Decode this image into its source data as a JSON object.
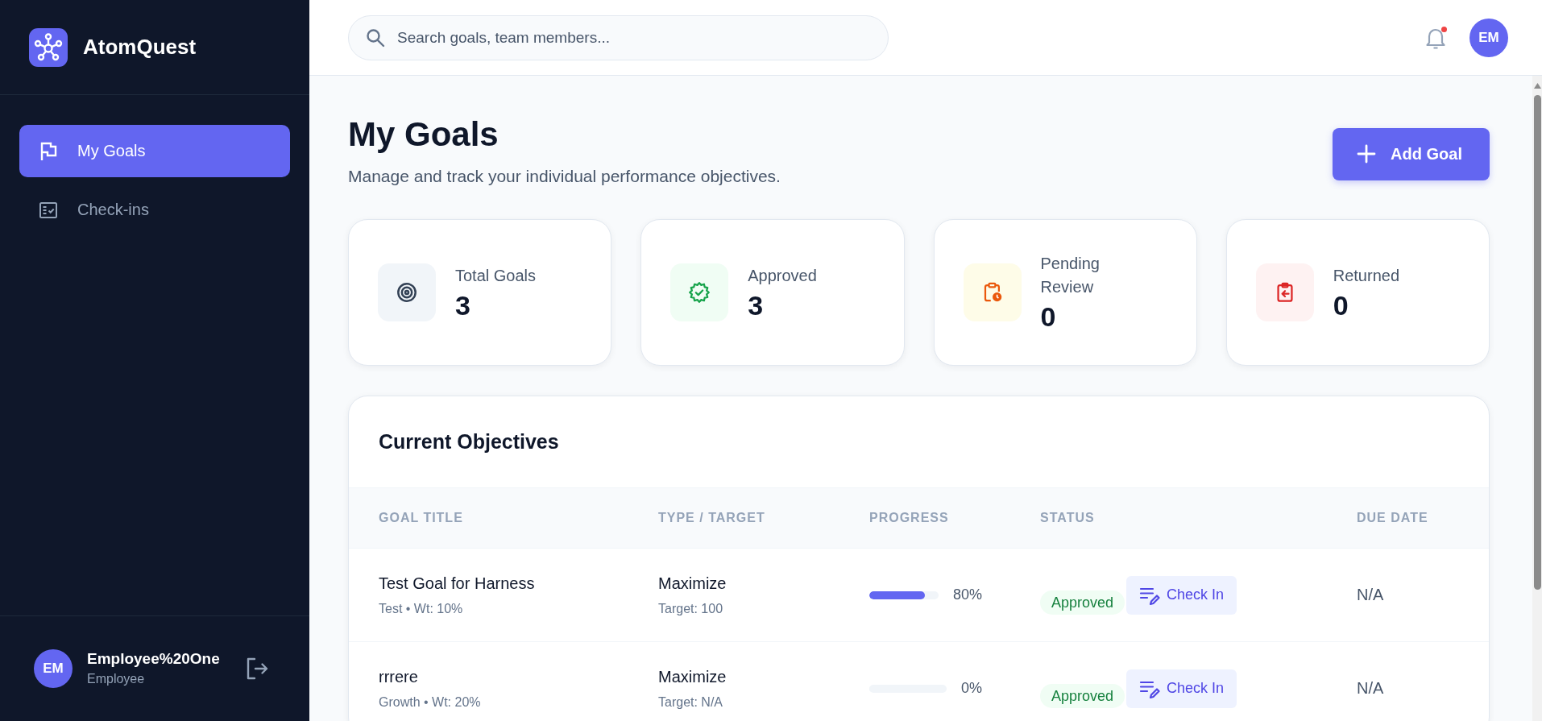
{
  "sidebar": {
    "brand": "AtomQuest",
    "nav_items": [
      {
        "label": "My Goals",
        "kind": "goals",
        "selected": true
      },
      {
        "label": "Check-ins",
        "kind": "checkins",
        "selected": false
      }
    ],
    "user": {
      "initials": "EM",
      "name": "Employee%20One",
      "role": "Employee"
    }
  },
  "topbar": {
    "search": {
      "placeholder": "Search goals, team members..."
    },
    "notifications": {
      "has_unread": true
    },
    "avatar": {
      "initials": "EM"
    }
  },
  "header": {
    "title": "My Goals",
    "subtitle": "Manage and track your individual performance objectives.",
    "add_button": {
      "label": "Add Goal"
    }
  },
  "stats": [
    {
      "kind": "total",
      "label": "Total Goals",
      "value": "3"
    },
    {
      "kind": "approved",
      "label": "Approved",
      "value": "3"
    },
    {
      "kind": "pending",
      "label": "Pending Review",
      "value": "0"
    },
    {
      "kind": "returned",
      "label": "Returned",
      "value": "0"
    }
  ],
  "objectives": {
    "title": "Current Objectives",
    "columns": [
      "GOAL TITLE",
      "TYPE / TARGET",
      "PROGRESS",
      "STATUS",
      "DUE DATE"
    ],
    "rows": [
      {
        "title": "Test Goal for Harness",
        "meta": "Test • Wt: 10%",
        "type": "Maximize",
        "target": "Target: 100",
        "level": 0.8,
        "progress": "80%",
        "status": {
          "label": "Approved",
          "kind": "approved"
        },
        "action": "Check In",
        "due_date": "N/A"
      },
      {
        "title": "rrrere",
        "meta": "Growth • Wt: 20%",
        "type": "Maximize",
        "target": "Target: N/A",
        "level": 0,
        "progress": "0%",
        "status": {
          "label": "Approved",
          "kind": "approved"
        },
        "action": "Check In",
        "due_date": "N/A"
      }
    ]
  }
}
